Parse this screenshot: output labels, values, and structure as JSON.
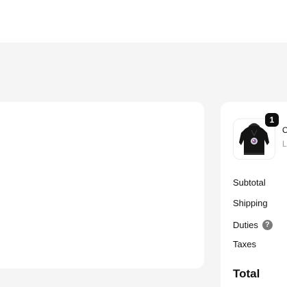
{
  "summary": {
    "product": {
      "quantity": "1",
      "image_icon": "black-hoodie-image",
      "name_partial": "C",
      "subtitle_partial": "L"
    },
    "labels": {
      "subtotal": "Subtotal",
      "shipping": "Shipping",
      "duties": "Duties",
      "duties_help": "?",
      "taxes": "Taxes",
      "total": "Total"
    }
  },
  "colors": {
    "page_background": "#f5f5f5",
    "card_background": "#ffffff",
    "badge_background": "#0f0f0f",
    "help_icon_background": "#7b7b7b"
  }
}
